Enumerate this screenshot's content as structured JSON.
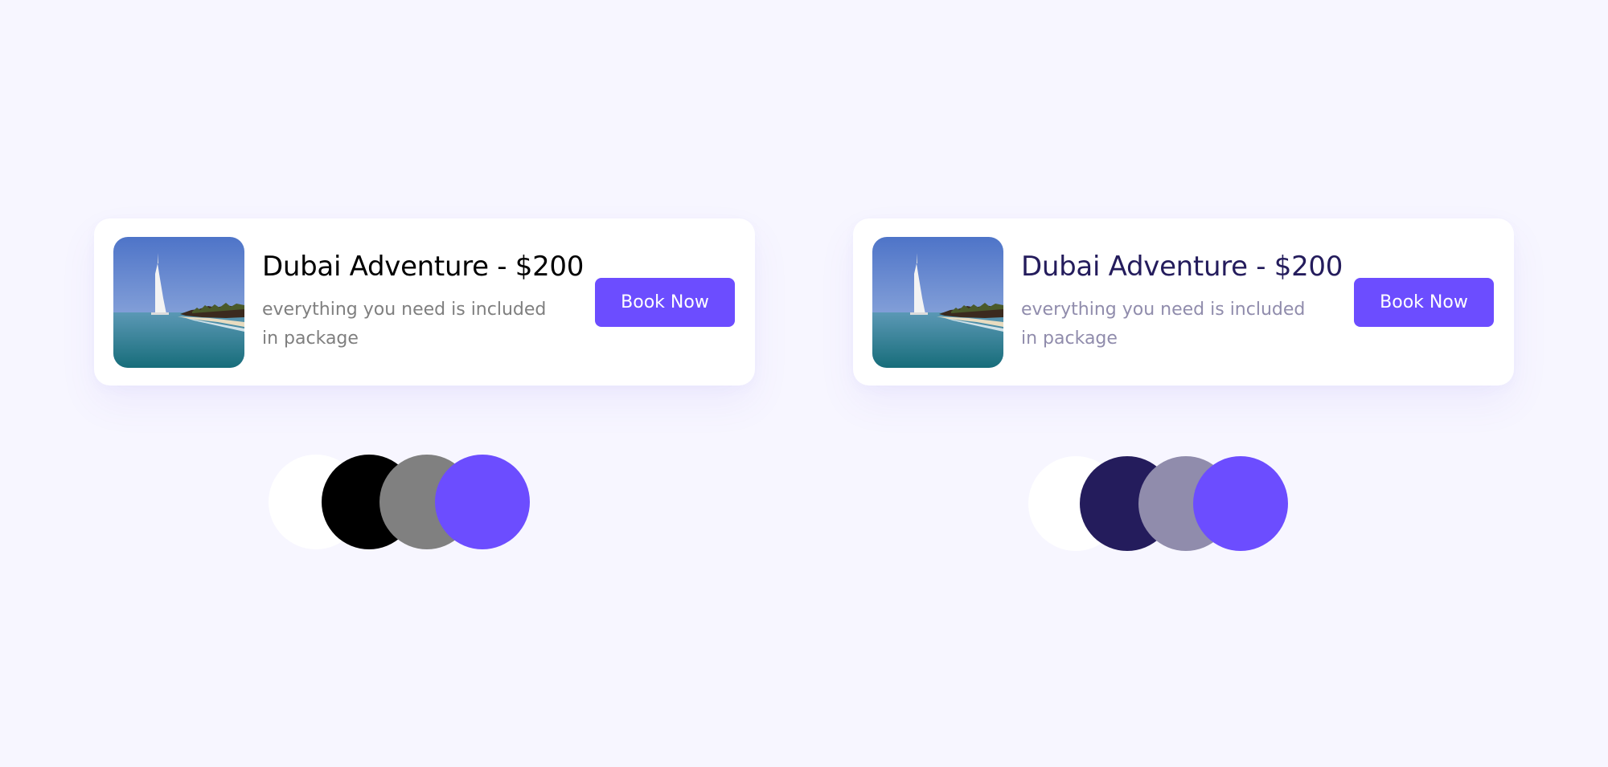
{
  "cards": [
    {
      "title": "Dubai Adventure - $200",
      "description": "everything you need is included in package",
      "button_label": "Book Now",
      "title_color": "#000000",
      "description_color": "#7f7f7f",
      "button_color": "#6c4dff",
      "swatches": [
        "#ffffff",
        "#000000",
        "#808080",
        "#6c4dff"
      ]
    },
    {
      "title": "Dubai Adventure - $200",
      "description": "everything you need is included in package",
      "button_label": "Book Now",
      "title_color": "#241c5c",
      "description_color": "#908cac",
      "button_color": "#6c4dff",
      "swatches": [
        "#ffffff",
        "#241c5c",
        "#908cac",
        "#6c4dff"
      ]
    }
  ],
  "thumbnail": {
    "icon": "dubai-beach-photo",
    "sky_top": "#4e74c8",
    "sky_bottom": "#a7bde3",
    "sea_top": "#5b98b5",
    "sea_bottom": "#176d7a"
  }
}
